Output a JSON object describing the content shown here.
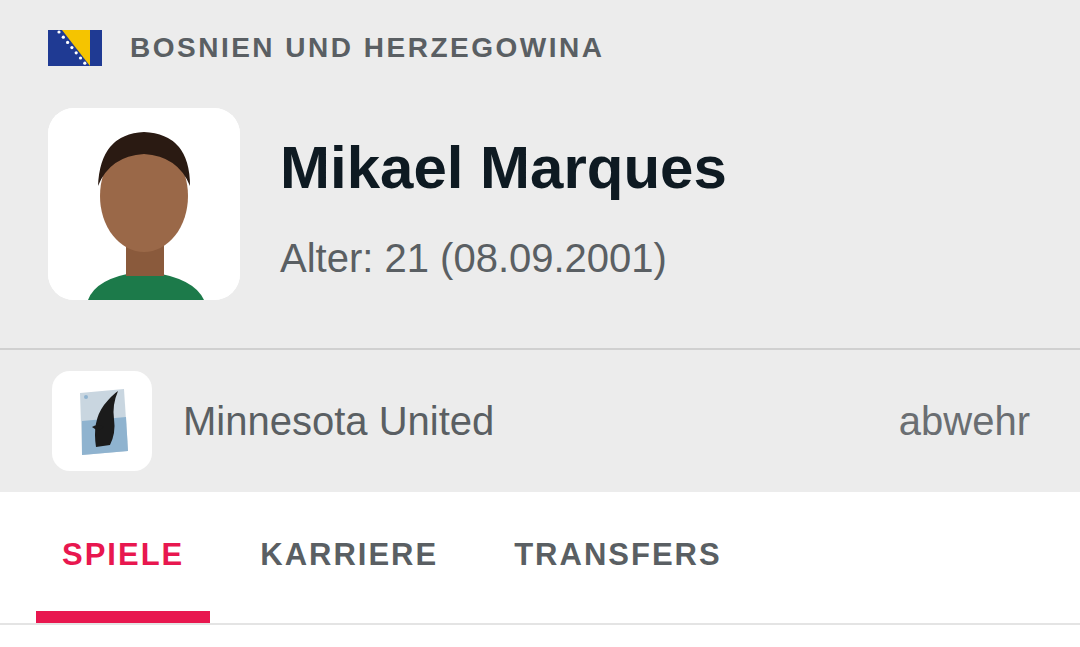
{
  "header": {
    "country": "BOSNIEN UND HERZEGOWINA",
    "name": "Mikael Marques",
    "age": "Alter: 21 (08.09.2001)"
  },
  "team": {
    "name": "Minnesota United",
    "position": "abwehr"
  },
  "tabs": [
    {
      "label": "SPIELE",
      "selected": true
    },
    {
      "label": "KARRIERE",
      "selected": false
    },
    {
      "label": "TRANSFERS",
      "selected": false
    }
  ]
}
